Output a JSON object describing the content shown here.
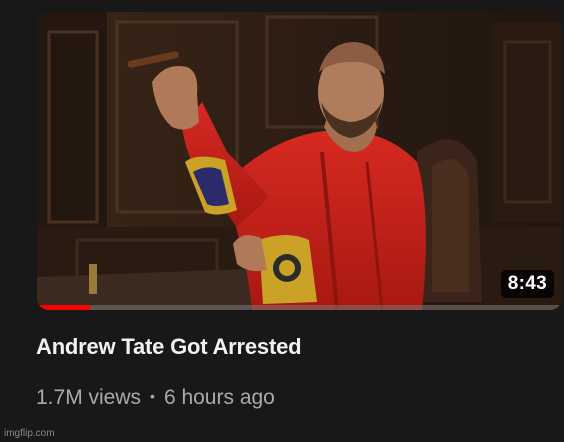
{
  "video": {
    "title": "Andrew Tate Got Arrested",
    "views": "1.7M views",
    "separator": "•",
    "age": "6 hours ago",
    "duration": "8:43",
    "watched_fraction": 0.1,
    "thumbnail_icon": "man-in-red-robe-with-cigar-thumbnail"
  },
  "watermark": "imgflip.com",
  "colors": {
    "background": "#181818",
    "progress": "#ff0000",
    "title": "#f1f1f1",
    "meta": "#aaaaaa"
  }
}
